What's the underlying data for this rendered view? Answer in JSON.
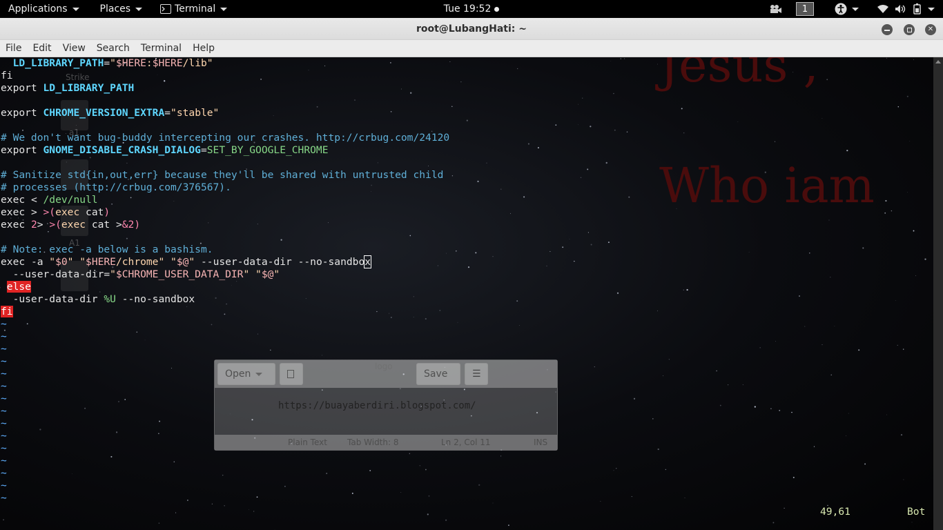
{
  "panel": {
    "applications": "Applications",
    "places": "Places",
    "terminal_menu": "Terminal",
    "clock": "Tue 19:52",
    "workspace": "1"
  },
  "window": {
    "title": "root@LubangHati: ~"
  },
  "menu": [
    "File",
    "Edit",
    "View",
    "Search",
    "Terminal",
    "Help"
  ],
  "background": {
    "text1": "Jesus ,",
    "text2": "Who iam"
  },
  "ghost_desktop": {
    "labels": [
      "Strike",
      "a1",
      "A1"
    ]
  },
  "ghost_editor": {
    "open_label": "Open",
    "save_label": "Save",
    "title": "logo",
    "content": "https://buayaberdiri.blogspot.com/",
    "status_lang": "Plain Text",
    "status_tab": "Tab Width: 8",
    "status_pos": "Ln 2, Col 11",
    "status_mode": "INS"
  },
  "vim": {
    "lines": [
      [
        [
          "  ",
          ""
        ],
        [
          "LD_LIBRARY_PATH",
          "var"
        ],
        [
          "=",
          "kw"
        ],
        [
          "\"",
          "str"
        ],
        [
          "$HERE",
          "sv"
        ],
        [
          ":",
          "str"
        ],
        [
          "$HERE",
          "sv"
        ],
        [
          "/lib\"",
          "str"
        ]
      ],
      [
        [
          "fi",
          "kw"
        ]
      ],
      [
        [
          "export ",
          "kw"
        ],
        [
          "LD_LIBRARY_PATH",
          "var"
        ]
      ],
      [],
      [
        [
          "export ",
          "kw"
        ],
        [
          "CHROME_VERSION_EXTRA",
          "var"
        ],
        [
          "=",
          "kw"
        ],
        [
          "\"stable\"",
          "str"
        ]
      ],
      [],
      [
        [
          "# We don't want bug-buddy intercepting our crashes. http://crbug.com/24120",
          "cm"
        ]
      ],
      [
        [
          "export ",
          "kw"
        ],
        [
          "GNOME_DISABLE_CRASH_DIALOG",
          "var"
        ],
        [
          "=",
          "kw"
        ],
        [
          "SET_BY_GOOGLE_CHROME",
          "gr"
        ]
      ],
      [],
      [
        [
          "# Sanitize std{in,out,err} because they'll be shared with untrusted child",
          "cm"
        ]
      ],
      [
        [
          "# processes (http://crbug.com/376567).",
          "cm"
        ]
      ],
      [
        [
          "exec ",
          "kw"
        ],
        [
          "< ",
          "kw"
        ],
        [
          "/dev/null",
          "gr"
        ]
      ],
      [
        [
          "exec ",
          "kw"
        ],
        [
          "> ",
          "kw"
        ],
        [
          ">(",
          "pk"
        ],
        [
          "exec ",
          "str"
        ],
        [
          "cat",
          "kw"
        ],
        [
          ")",
          "pk"
        ]
      ],
      [
        [
          "exec ",
          "kw"
        ],
        [
          "2",
          "pk"
        ],
        [
          "> ",
          "kw"
        ],
        [
          ">(",
          "pk"
        ],
        [
          "exec ",
          "str"
        ],
        [
          "cat >",
          "kw"
        ],
        [
          "&2",
          "pk"
        ],
        [
          ")",
          "pk"
        ]
      ],
      [],
      [
        [
          "# Note: exec -a below is a bashism.",
          "cm"
        ]
      ],
      [
        [
          "exec ",
          "kw"
        ],
        [
          "-a ",
          "kw"
        ],
        [
          "\"",
          "str"
        ],
        [
          "$0",
          "sv"
        ],
        [
          "\" \"",
          "str"
        ],
        [
          "$HERE",
          "sv"
        ],
        [
          "/chrome\" \"",
          "str"
        ],
        [
          "$@",
          "sv"
        ],
        [
          "\"",
          "str"
        ],
        [
          " --user-data-dir --no-sandbo",
          "kw"
        ],
        [
          "x",
          "cursor"
        ]
      ],
      [
        [
          "  --user-data-dir=",
          "kw"
        ],
        [
          "\"",
          "str"
        ],
        [
          "$CHROME_USER_DATA_DIR",
          "sv"
        ],
        [
          "\" \"",
          "str"
        ],
        [
          "$@",
          "sv"
        ],
        [
          "\"",
          "str"
        ]
      ],
      [
        [
          " ",
          ""
        ],
        [
          "else",
          "err"
        ]
      ],
      [
        [
          "  -user-data-dir ",
          "kw"
        ],
        [
          "%U",
          "gr"
        ],
        [
          " --no-sandbox",
          "kw"
        ]
      ],
      [
        [
          "fi",
          "err"
        ]
      ],
      [
        [
          "~",
          "tilde"
        ]
      ],
      [
        [
          "~",
          "tilde"
        ]
      ],
      [
        [
          "~",
          "tilde"
        ]
      ],
      [
        [
          "~",
          "tilde"
        ]
      ],
      [
        [
          "~",
          "tilde"
        ]
      ],
      [
        [
          "~",
          "tilde"
        ]
      ],
      [
        [
          "~",
          "tilde"
        ]
      ],
      [
        [
          "~",
          "tilde"
        ]
      ],
      [
        [
          "~",
          "tilde"
        ]
      ],
      [
        [
          "~",
          "tilde"
        ]
      ],
      [
        [
          "~",
          "tilde"
        ]
      ],
      [
        [
          "~",
          "tilde"
        ]
      ],
      [
        [
          "~",
          "tilde"
        ]
      ],
      [
        [
          "~",
          "tilde"
        ]
      ],
      [
        [
          "~",
          "tilde"
        ]
      ]
    ],
    "position": "49,61",
    "scroll": "Bot"
  },
  "colors": {
    "error_bg": "#e02424",
    "variable": "#5fd7ff",
    "comment": "#5fafd7"
  }
}
